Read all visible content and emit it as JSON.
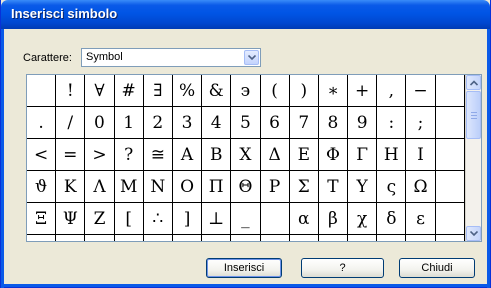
{
  "window": {
    "title": "Inserisci simbolo"
  },
  "font": {
    "label": "Carattere:",
    "selected": "Symbol"
  },
  "symbol_rows": [
    [
      "",
      "!",
      "∀",
      "#",
      "∃",
      "%",
      "&",
      "϶",
      "(",
      ")",
      "∗",
      "+",
      ",",
      "−",
      ""
    ],
    [
      ".",
      "/",
      "0",
      "1",
      "2",
      "3",
      "4",
      "5",
      "6",
      "7",
      "8",
      "9",
      ":",
      ";",
      ""
    ],
    [
      "<",
      "=",
      ">",
      "?",
      "≅",
      "Α",
      "Β",
      "Χ",
      "Δ",
      "Ε",
      "Φ",
      "Γ",
      "Η",
      "Ι",
      ""
    ],
    [
      "ϑ",
      "Κ",
      "Λ",
      "Μ",
      "Ν",
      "Ο",
      "Π",
      "Θ",
      "Ρ",
      "Σ",
      "Τ",
      "Υ",
      "ς",
      "Ω",
      ""
    ],
    [
      "Ξ",
      "Ψ",
      "Ζ",
      "[",
      "∴",
      "]",
      "⊥",
      "_",
      "",
      "α",
      "β",
      "χ",
      "δ",
      "ε",
      ""
    ],
    [
      "",
      "",
      "",
      "",
      "",
      "",
      "",
      "",
      "",
      "",
      "",
      "",
      "",
      "",
      ""
    ]
  ],
  "buttons": {
    "insert": "Inserisci",
    "help": "?",
    "close": "Chiudi"
  },
  "scrollbar": {
    "position": 0.0
  },
  "colors": {
    "titlebar": "#0055e5",
    "dialog_bg": "#ece9d8",
    "border": "#7f9db9"
  }
}
